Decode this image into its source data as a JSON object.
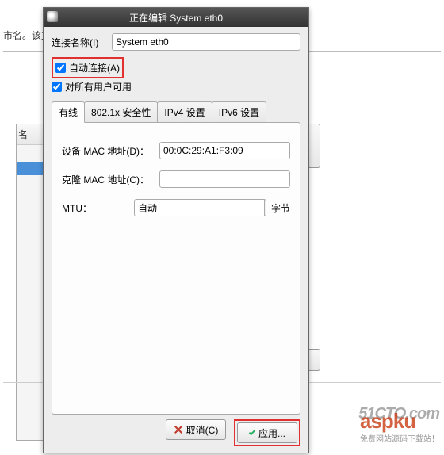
{
  "background": {
    "text_fragment": "市名。该主",
    "panel_header": "名",
    "watermark1": "51CTO.com",
    "watermark2": "aspku",
    "watermark2_sub": "免费网站源码下载站！"
  },
  "dialog": {
    "title": "正在编辑 System eth0",
    "connection_name_label": "连接名称(I)",
    "connection_name_value": "System eth0",
    "auto_connect_label": "自动连接(A)",
    "auto_connect_checked": true,
    "all_users_label": "对所有用户可用",
    "all_users_checked": true,
    "tabs": [
      {
        "label": "有线",
        "active": true
      },
      {
        "label": "802.1x 安全性",
        "active": false
      },
      {
        "label": "IPv4 设置",
        "active": false
      },
      {
        "label": "IPv6 设置",
        "active": false
      }
    ],
    "wired": {
      "device_mac_label": "设备 MAC 地址(D)：",
      "device_mac_value": "00:0C:29:A1:F3:09",
      "cloned_mac_label": "克隆 MAC 地址(C)：",
      "cloned_mac_value": "",
      "mtu_label": "MTU：",
      "mtu_value": "自动",
      "mtu_unit": "字节"
    },
    "buttons": {
      "cancel": "取消(C)",
      "apply": "应用..."
    }
  }
}
